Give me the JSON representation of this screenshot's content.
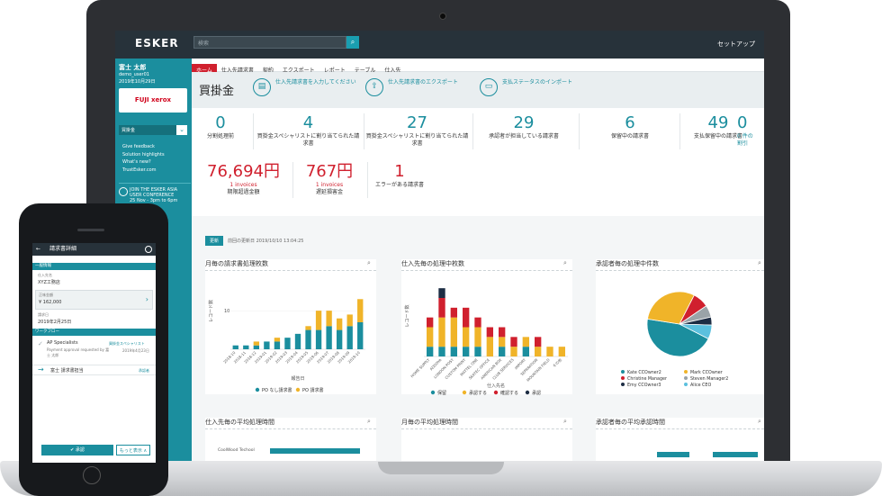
{
  "app": {
    "logo": "ESKER",
    "search_placeholder": "検索",
    "setup": "セットアップ"
  },
  "user": {
    "name": "富士 太郎",
    "id": "demo_user01",
    "date": "2019年10月29日"
  },
  "company_logo": "FUJI xerox",
  "module": {
    "label": "買掛金"
  },
  "sidebar_links": [
    "Give feedback",
    "Solution highlights",
    "What's new?",
    "TrustEsker.com"
  ],
  "conference": {
    "title": "JOIN THE ESKER ASIA USER CONFERENCE",
    "sub": "25 Nov - 3pm to 6pm"
  },
  "nav": [
    "ホーム",
    "仕入先請求書",
    "契約",
    "エクスポート",
    "レポート",
    "テーブル",
    "仕入先"
  ],
  "page_title": "買掛金",
  "actions": [
    {
      "icon": "invoice-icon",
      "label": "仕入先請求書を入力してください"
    },
    {
      "icon": "export-icon",
      "label": "仕入先請求書のエクスポート"
    },
    {
      "icon": "payment-icon",
      "label": "支払ステータスのインポート"
    }
  ],
  "kpis": [
    {
      "value": "0",
      "label": "分割処理前"
    },
    {
      "value": "4",
      "label": "買掛金スペシャリストに割り当てられた請求書"
    },
    {
      "value": "27",
      "label": "買掛金スペシャリストに割り当てられた請求書"
    },
    {
      "value": "29",
      "label": "承認者が担当している請求書"
    },
    {
      "value": "6",
      "label": "保留中の請求書"
    },
    {
      "value": "49",
      "label": "支払保留中の請求書"
    },
    {
      "value": "0",
      "label": "0 件の\n割引"
    }
  ],
  "kpis2": [
    {
      "value": "76,694円",
      "sub": "1 invoices",
      "label": "期限超過金額",
      "color": "#d0202e"
    },
    {
      "value": "767円",
      "sub": "1 invoices",
      "label": "遅延損害金",
      "color": "#d0202e"
    },
    {
      "value": "1",
      "sub": "",
      "label": "エラーがある請求書",
      "color": "#d0202e"
    }
  ],
  "refresh": {
    "button": "更新",
    "text": "前回の更新日 2019/10/10 13:04:25"
  },
  "panels": {
    "monthly": {
      "title": "月毎の請求書処理枚数",
      "ylabel": "レコード数",
      "xlabel": "報告日",
      "y_tick": "10",
      "legend": [
        "PO なし請求書",
        "PO 請求書"
      ]
    },
    "supplier": {
      "title": "仕入先毎の処理中枚数",
      "ylabel": "レコード数",
      "xlabel": "仕入先名",
      "legend": [
        "保留",
        "承認する",
        "確認する",
        "承認"
      ]
    },
    "approver": {
      "title": "承認者毎の処理中件数",
      "legend": [
        "Kate CCOwner2",
        "Mark CCOwner",
        "Christine Manager",
        "Steven Manager2",
        "Emy CCOwner3",
        "Alice CEO"
      ]
    },
    "avg_supplier": {
      "title": "仕入先毎の平均処理時間",
      "row": "CoolWood Techool"
    },
    "avg_month": {
      "title": "月毎の平均処理時間"
    },
    "avg_approver": {
      "title": "承認者毎の平均承認時間"
    }
  },
  "chart_data": [
    {
      "type": "bar",
      "title": "月毎の請求書処理枚数",
      "xlabel": "報告日",
      "ylabel": "レコード数",
      "categories": [
        "2018-10",
        "2018-11",
        "2018-12",
        "2019-01",
        "2019-02",
        "2019-03",
        "2019-04",
        "2019-05",
        "2019-06",
        "2019-07",
        "2019-08",
        "2019-09",
        "2019-10"
      ],
      "series": [
        {
          "name": "PO なし請求書",
          "values": [
            1,
            1,
            1,
            2,
            2,
            3,
            4,
            5,
            5,
            6,
            5,
            6,
            7
          ]
        },
        {
          "name": "PO 請求書",
          "values": [
            0,
            0,
            1,
            0,
            1,
            0,
            0,
            1,
            5,
            4,
            3,
            3,
            6
          ]
        }
      ],
      "colors": [
        "#1b8e9e",
        "#f0b429"
      ]
    },
    {
      "type": "bar",
      "title": "仕入先毎の処理中枚数",
      "xlabel": "仕入先名",
      "ylabel": "レコード数",
      "categories": [
        "HOME SUPPLY",
        "ADDOYA",
        "LONDON POST",
        "CUSTOM PRINT",
        "MATTEL ONE",
        "SKATEC OFFICE",
        "AMERICAN BOX",
        "CLUB SERVICES",
        "IMPORT",
        "SEPARATION",
        "MOUNTAIN FIELD",
        "その他"
      ],
      "series": [
        {
          "name": "保留",
          "values": [
            1,
            1,
            1,
            1,
            1,
            0,
            1,
            0,
            1,
            0,
            0,
            0
          ]
        },
        {
          "name": "承認する",
          "values": [
            2,
            3,
            3,
            2,
            2,
            2,
            1,
            1,
            1,
            1,
            1,
            1
          ]
        },
        {
          "name": "確認する",
          "values": [
            1,
            2,
            1,
            2,
            1,
            1,
            1,
            1,
            0,
            1,
            0,
            0
          ]
        },
        {
          "name": "承認",
          "values": [
            0,
            1,
            0,
            0,
            0,
            0,
            0,
            0,
            0,
            0,
            0,
            0
          ]
        }
      ],
      "colors": [
        "#1b8e9e",
        "#f0b429",
        "#d0202e",
        "#1d2d44"
      ]
    },
    {
      "type": "pie",
      "title": "承認者毎の処理中件数",
      "categories": [
        "Kate CCOwner2",
        "Mark CCOwner",
        "Christine Manager",
        "Steven Manager2",
        "Emy CCOwner3",
        "Alice CEO"
      ],
      "values": [
        45,
        30,
        8,
        6,
        4,
        7
      ],
      "colors": [
        "#1b8e9e",
        "#f0b429",
        "#d0202e",
        "#9aa3a8",
        "#1d2d44",
        "#5bc0de"
      ]
    }
  ],
  "phone": {
    "title": "請求書詳細",
    "section1": "一般情報",
    "supplier_label": "仕入先名",
    "supplier": "XYZ工務店",
    "amount_label": "正味金額",
    "amount": "¥ 162,000",
    "date_label": "請求日",
    "date": "2019年2月25日",
    "section2": "ワークフロー",
    "wf1_name": "AP Specialists",
    "wf1_role": "買掛金スペシャリスト",
    "wf1_note": "Payment approval requested by 富士 太郎",
    "wf1_date": "2019年4月23日",
    "wf2_name": "富士 請求書担当",
    "wf2_role": "承認者",
    "approve": "承認",
    "more": "もっと表示 ∧"
  }
}
